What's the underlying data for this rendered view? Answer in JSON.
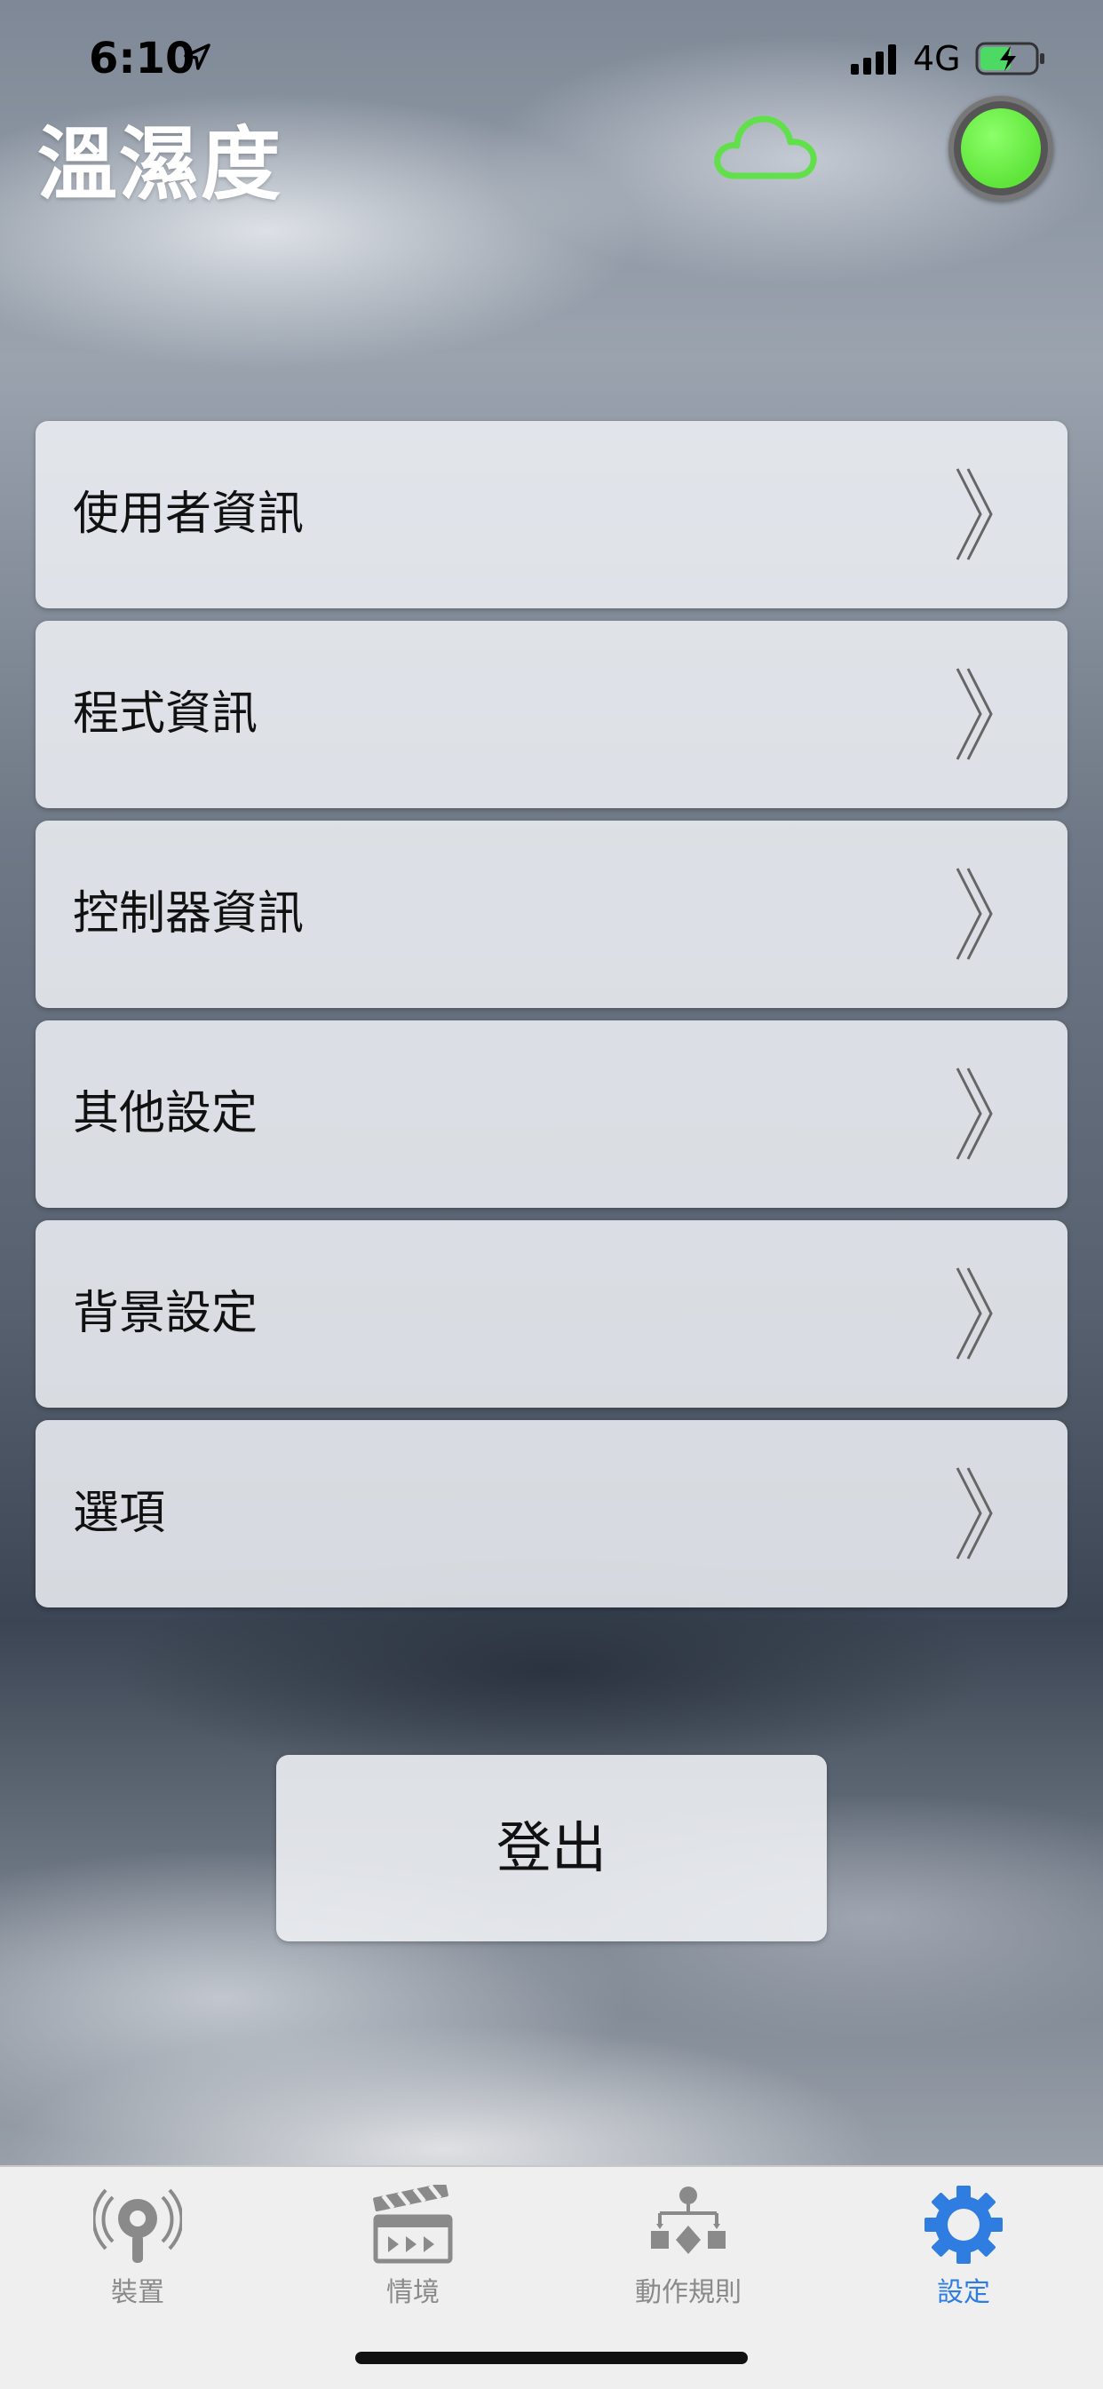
{
  "status_bar": {
    "time": "6:10",
    "network": "4G",
    "icons": [
      "location-arrow-icon",
      "signal-icon",
      "battery-charging-icon"
    ]
  },
  "header": {
    "title": "溫濕度",
    "cloud_icon": "cloud-icon",
    "status_color": "#5fe53a"
  },
  "menu": {
    "items": [
      {
        "label": "使用者資訊"
      },
      {
        "label": "程式資訊"
      },
      {
        "label": "控制器資訊"
      },
      {
        "label": "其他設定"
      },
      {
        "label": "背景設定"
      },
      {
        "label": "選項"
      }
    ]
  },
  "logout": {
    "label": "登出"
  },
  "tabbar": {
    "active_color": "#2f7de1",
    "inactive_color": "#8a8a8a",
    "tabs": [
      {
        "label": "裝置",
        "icon": "device-signal-icon"
      },
      {
        "label": "情境",
        "icon": "clapperboard-icon"
      },
      {
        "label": "動作規則",
        "icon": "flowchart-icon"
      },
      {
        "label": "設定",
        "icon": "gear-icon"
      }
    ],
    "active_index": 3
  }
}
